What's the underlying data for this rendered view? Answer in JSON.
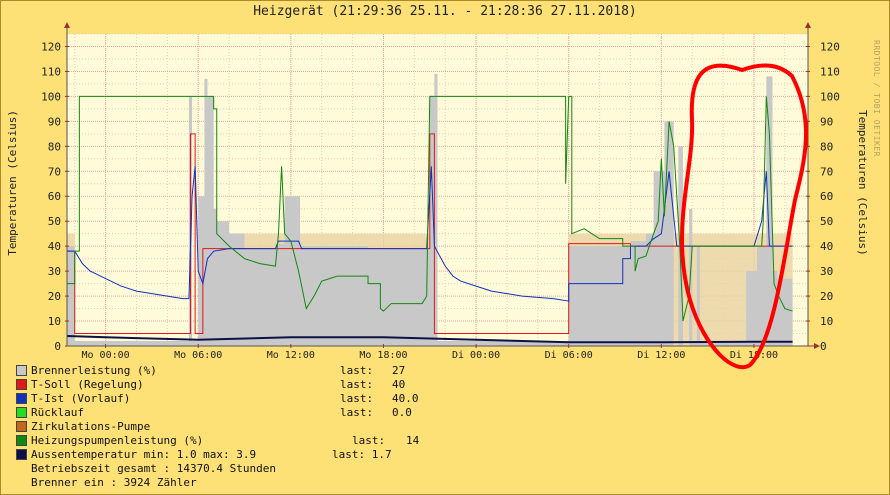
{
  "title": "Heizgerät (21:29:36 25.11. - 21:28:36 27.11.2018)",
  "watermark": "RRDTOOL / TOBI OETIKER",
  "y_axis_label": "Temperaturen (Celsius)",
  "colors": {
    "background": "#fde176",
    "plot_background": "#fffbd8",
    "grid_minor": "#e8ccc0",
    "grid_major": "#e9a7a1",
    "brenner": "#c8c8c8",
    "brenner_swatch": "#c8c8c8",
    "soll": "#e01818",
    "ist": "#1030c0",
    "ruecklauf": "#22dd22",
    "zirkulation": "#c0681a",
    "pumpe": "#118811",
    "aussen": "#101048",
    "outside_fill": "#e9d3a3",
    "annotation": "#ff0000"
  },
  "legend": [
    {
      "label": "Brennerleistung (%)",
      "last_label": "last:",
      "last_value": "27",
      "color": "#c8c8c8"
    },
    {
      "label": "T-Soll (Regelung)",
      "last_label": "last:",
      "last_value": "40",
      "color": "#e01818"
    },
    {
      "label": "T-Ist  (Vorlauf)",
      "last_label": "last:",
      "last_value": "40.0",
      "color": "#1030c0"
    },
    {
      "label": "Rücklauf",
      "last_label": "last:",
      "last_value": "0.0",
      "color": "#22dd22"
    },
    {
      "label": "Zirkulations-Pumpe",
      "last_label": "",
      "last_value": "",
      "color": "#c0681a"
    },
    {
      "label": "Heizungspumpenleistung (%)",
      "last_label": "last:",
      "last_value": "14",
      "color": "#118811"
    }
  ],
  "aussen": {
    "label": "Aussentemperatur min:  1.0  max:  3.9",
    "last": "last:  1.7",
    "color": "#101048"
  },
  "betrieb": "Betriebszeit gesamt : 14370.4 Stunden",
  "brenner_ein": "Brenner ein        :   3924 Zähler",
  "chart_data": {
    "type": "line",
    "title": "Heizgerät (21:29:36 25.11. - 21:28:36 27.11.2018)",
    "ylabel": "Temperaturen (Celsius)",
    "xlabel": "",
    "ylim": [
      0,
      125
    ],
    "yticks": [
      0,
      10,
      20,
      30,
      40,
      50,
      60,
      70,
      80,
      90,
      100,
      110,
      120
    ],
    "xlim": [
      21.5,
      69.5
    ],
    "x_unit": "hours since 25.11. 00:00",
    "x_ticks": [
      {
        "x": 24,
        "label": "Mo 00:00"
      },
      {
        "x": 30,
        "label": "Mo 06:00"
      },
      {
        "x": 36,
        "label": "Mo 12:00"
      },
      {
        "x": 42,
        "label": "Mo 18:00"
      },
      {
        "x": 48,
        "label": "Di 00:00"
      },
      {
        "x": 54,
        "label": "Di 06:00"
      },
      {
        "x": 60,
        "label": "Di 12:00"
      },
      {
        "x": 66,
        "label": "Di 18:00"
      }
    ],
    "grid": true,
    "series": [
      {
        "name": "Brennerleistung (%)",
        "style": "area",
        "color": "#c8c8c8",
        "points": [
          [
            21.5,
            40
          ],
          [
            22,
            40
          ],
          [
            22,
            2
          ],
          [
            29.4,
            2
          ],
          [
            29.4,
            100
          ],
          [
            29.6,
            100
          ],
          [
            29.6,
            2
          ],
          [
            30,
            2
          ],
          [
            30,
            60
          ],
          [
            30.4,
            60
          ],
          [
            30.4,
            107
          ],
          [
            30.6,
            107
          ],
          [
            30.6,
            100
          ],
          [
            31,
            100
          ],
          [
            31,
            55
          ],
          [
            31.2,
            55
          ],
          [
            31.2,
            50
          ],
          [
            32,
            50
          ],
          [
            32,
            45
          ],
          [
            33,
            45
          ],
          [
            33,
            39
          ],
          [
            35,
            39
          ],
          [
            35,
            41
          ],
          [
            35.6,
            41
          ],
          [
            35.6,
            60
          ],
          [
            36.6,
            60
          ],
          [
            36.6,
            40
          ],
          [
            41,
            40
          ],
          [
            41,
            39
          ],
          [
            45,
            39
          ],
          [
            45,
            100
          ],
          [
            45.3,
            100
          ],
          [
            45.3,
            109
          ],
          [
            45.5,
            109
          ],
          [
            45.5,
            2
          ],
          [
            54,
            2
          ],
          [
            54,
            40
          ],
          [
            58,
            40
          ],
          [
            58,
            42
          ],
          [
            59,
            42
          ],
          [
            59,
            45
          ],
          [
            59.5,
            45
          ],
          [
            59.5,
            70
          ],
          [
            60.2,
            70
          ],
          [
            60.2,
            90
          ],
          [
            60.8,
            90
          ],
          [
            60.8,
            0
          ],
          [
            61.1,
            0
          ],
          [
            61.1,
            80
          ],
          [
            61.4,
            80
          ],
          [
            61.4,
            0
          ],
          [
            61.8,
            0
          ],
          [
            61.8,
            55
          ],
          [
            62,
            55
          ],
          [
            62,
            2
          ],
          [
            62.3,
            2
          ],
          [
            62.3,
            40
          ],
          [
            62.5,
            40
          ],
          [
            62.5,
            2
          ],
          [
            65.5,
            2
          ],
          [
            65.5,
            30
          ],
          [
            66.2,
            30
          ],
          [
            66.2,
            40
          ],
          [
            66.8,
            40
          ],
          [
            66.8,
            108
          ],
          [
            67.2,
            108
          ],
          [
            67.2,
            30
          ],
          [
            67.5,
            30
          ],
          [
            67.5,
            27
          ],
          [
            68.5,
            27
          ]
        ]
      },
      {
        "name": "T-Soll (Regelung)",
        "style": "step",
        "color": "#e01818",
        "points": [
          [
            21.5,
            38
          ],
          [
            22,
            38
          ],
          [
            22,
            5
          ],
          [
            29.5,
            5
          ],
          [
            29.5,
            85
          ],
          [
            29.8,
            85
          ],
          [
            29.8,
            5
          ],
          [
            30.3,
            5
          ],
          [
            30.3,
            39
          ],
          [
            45,
            39
          ],
          [
            45,
            85
          ],
          [
            45.3,
            85
          ],
          [
            45.3,
            5
          ],
          [
            54,
            5
          ],
          [
            54,
            41
          ],
          [
            58,
            41
          ],
          [
            58,
            40
          ],
          [
            68.5,
            40
          ]
        ]
      },
      {
        "name": "T-Ist  (Vorlauf)",
        "style": "line",
        "color": "#1030c0",
        "points": [
          [
            21.5,
            38
          ],
          [
            22,
            38
          ],
          [
            22.5,
            33
          ],
          [
            23,
            30
          ],
          [
            24,
            27
          ],
          [
            25,
            24
          ],
          [
            26,
            22
          ],
          [
            27,
            21
          ],
          [
            28,
            20
          ],
          [
            29,
            19
          ],
          [
            29.4,
            19
          ],
          [
            29.6,
            60
          ],
          [
            29.8,
            72
          ],
          [
            30,
            30
          ],
          [
            30.3,
            25
          ],
          [
            30.6,
            35
          ],
          [
            31,
            38
          ],
          [
            32,
            39
          ],
          [
            35,
            39
          ],
          [
            35.2,
            42
          ],
          [
            36.5,
            42
          ],
          [
            36.7,
            39
          ],
          [
            41,
            39
          ],
          [
            44.8,
            39
          ],
          [
            45.1,
            72
          ],
          [
            45.3,
            40
          ],
          [
            46,
            32
          ],
          [
            46.5,
            28
          ],
          [
            47,
            26
          ],
          [
            48,
            24
          ],
          [
            49,
            22
          ],
          [
            50,
            21
          ],
          [
            51,
            20
          ],
          [
            52,
            19.5
          ],
          [
            53,
            19
          ],
          [
            54,
            18
          ],
          [
            54,
            25
          ],
          [
            57.5,
            25
          ],
          [
            57.5,
            35
          ],
          [
            58,
            35
          ],
          [
            58,
            40
          ],
          [
            59,
            40
          ],
          [
            59.5,
            43
          ],
          [
            60,
            45
          ],
          [
            60.5,
            70
          ],
          [
            61,
            40
          ],
          [
            61.5,
            40
          ],
          [
            62,
            40
          ],
          [
            62.5,
            40
          ],
          [
            62.6,
            40
          ],
          [
            65.5,
            40
          ],
          [
            66,
            40
          ],
          [
            66.5,
            50
          ],
          [
            66.8,
            70
          ],
          [
            67,
            40
          ],
          [
            68.5,
            40
          ]
        ]
      },
      {
        "name": "Heizungspumpenleistung (%)",
        "style": "step",
        "color": "#118811",
        "points": [
          [
            21.5,
            25
          ],
          [
            22,
            25
          ],
          [
            22,
            38
          ],
          [
            22.3,
            38
          ],
          [
            22.3,
            100
          ],
          [
            31,
            100
          ],
          [
            31,
            95
          ],
          [
            31.2,
            95
          ],
          [
            31.2,
            45
          ],
          [
            32,
            40
          ],
          [
            33,
            35
          ],
          [
            34,
            33
          ],
          [
            35,
            32
          ],
          [
            35.2,
            45
          ],
          [
            35.4,
            72
          ],
          [
            35.6,
            45
          ],
          [
            36,
            42
          ],
          [
            36.5,
            30
          ],
          [
            37,
            15
          ],
          [
            37.5,
            20
          ],
          [
            38,
            26
          ],
          [
            38.5,
            27
          ],
          [
            39,
            28
          ],
          [
            41,
            28
          ],
          [
            41,
            25
          ],
          [
            41.8,
            25
          ],
          [
            41.8,
            15
          ],
          [
            42,
            14
          ],
          [
            42.5,
            17
          ],
          [
            44.5,
            17
          ],
          [
            44.8,
            20
          ],
          [
            45,
            100
          ],
          [
            53.8,
            100
          ],
          [
            53.8,
            65
          ],
          [
            54,
            100
          ],
          [
            54.2,
            100
          ],
          [
            54.2,
            45
          ],
          [
            55,
            47
          ],
          [
            55.5,
            45
          ],
          [
            56,
            43
          ],
          [
            57.5,
            43
          ],
          [
            57.5,
            40
          ],
          [
            58.3,
            40
          ],
          [
            58.3,
            30
          ],
          [
            58.5,
            35
          ],
          [
            59,
            36
          ],
          [
            59.5,
            45
          ],
          [
            59.8,
            50
          ],
          [
            60,
            75
          ],
          [
            60.2,
            52
          ],
          [
            60.5,
            90
          ],
          [
            60.8,
            80
          ],
          [
            61,
            60
          ],
          [
            61.2,
            40
          ],
          [
            61.4,
            10
          ],
          [
            61.8,
            20
          ],
          [
            62,
            40
          ],
          [
            62.4,
            40
          ],
          [
            66.5,
            40
          ],
          [
            66.6,
            50
          ],
          [
            66.8,
            100
          ],
          [
            67,
            85
          ],
          [
            67.3,
            25
          ],
          [
            67.6,
            20
          ],
          [
            68,
            15
          ],
          [
            68.5,
            14
          ]
        ]
      },
      {
        "name": "Aussentemperatur",
        "style": "line",
        "color": "#101048",
        "points": [
          [
            21.5,
            4
          ],
          [
            24,
            3.5
          ],
          [
            30,
            2.5
          ],
          [
            36,
            3.5
          ],
          [
            42,
            3.5
          ],
          [
            48,
            2.5
          ],
          [
            54,
            1.5
          ],
          [
            60,
            1.5
          ],
          [
            66,
            1.7
          ],
          [
            68.5,
            1.7
          ]
        ]
      }
    ]
  }
}
